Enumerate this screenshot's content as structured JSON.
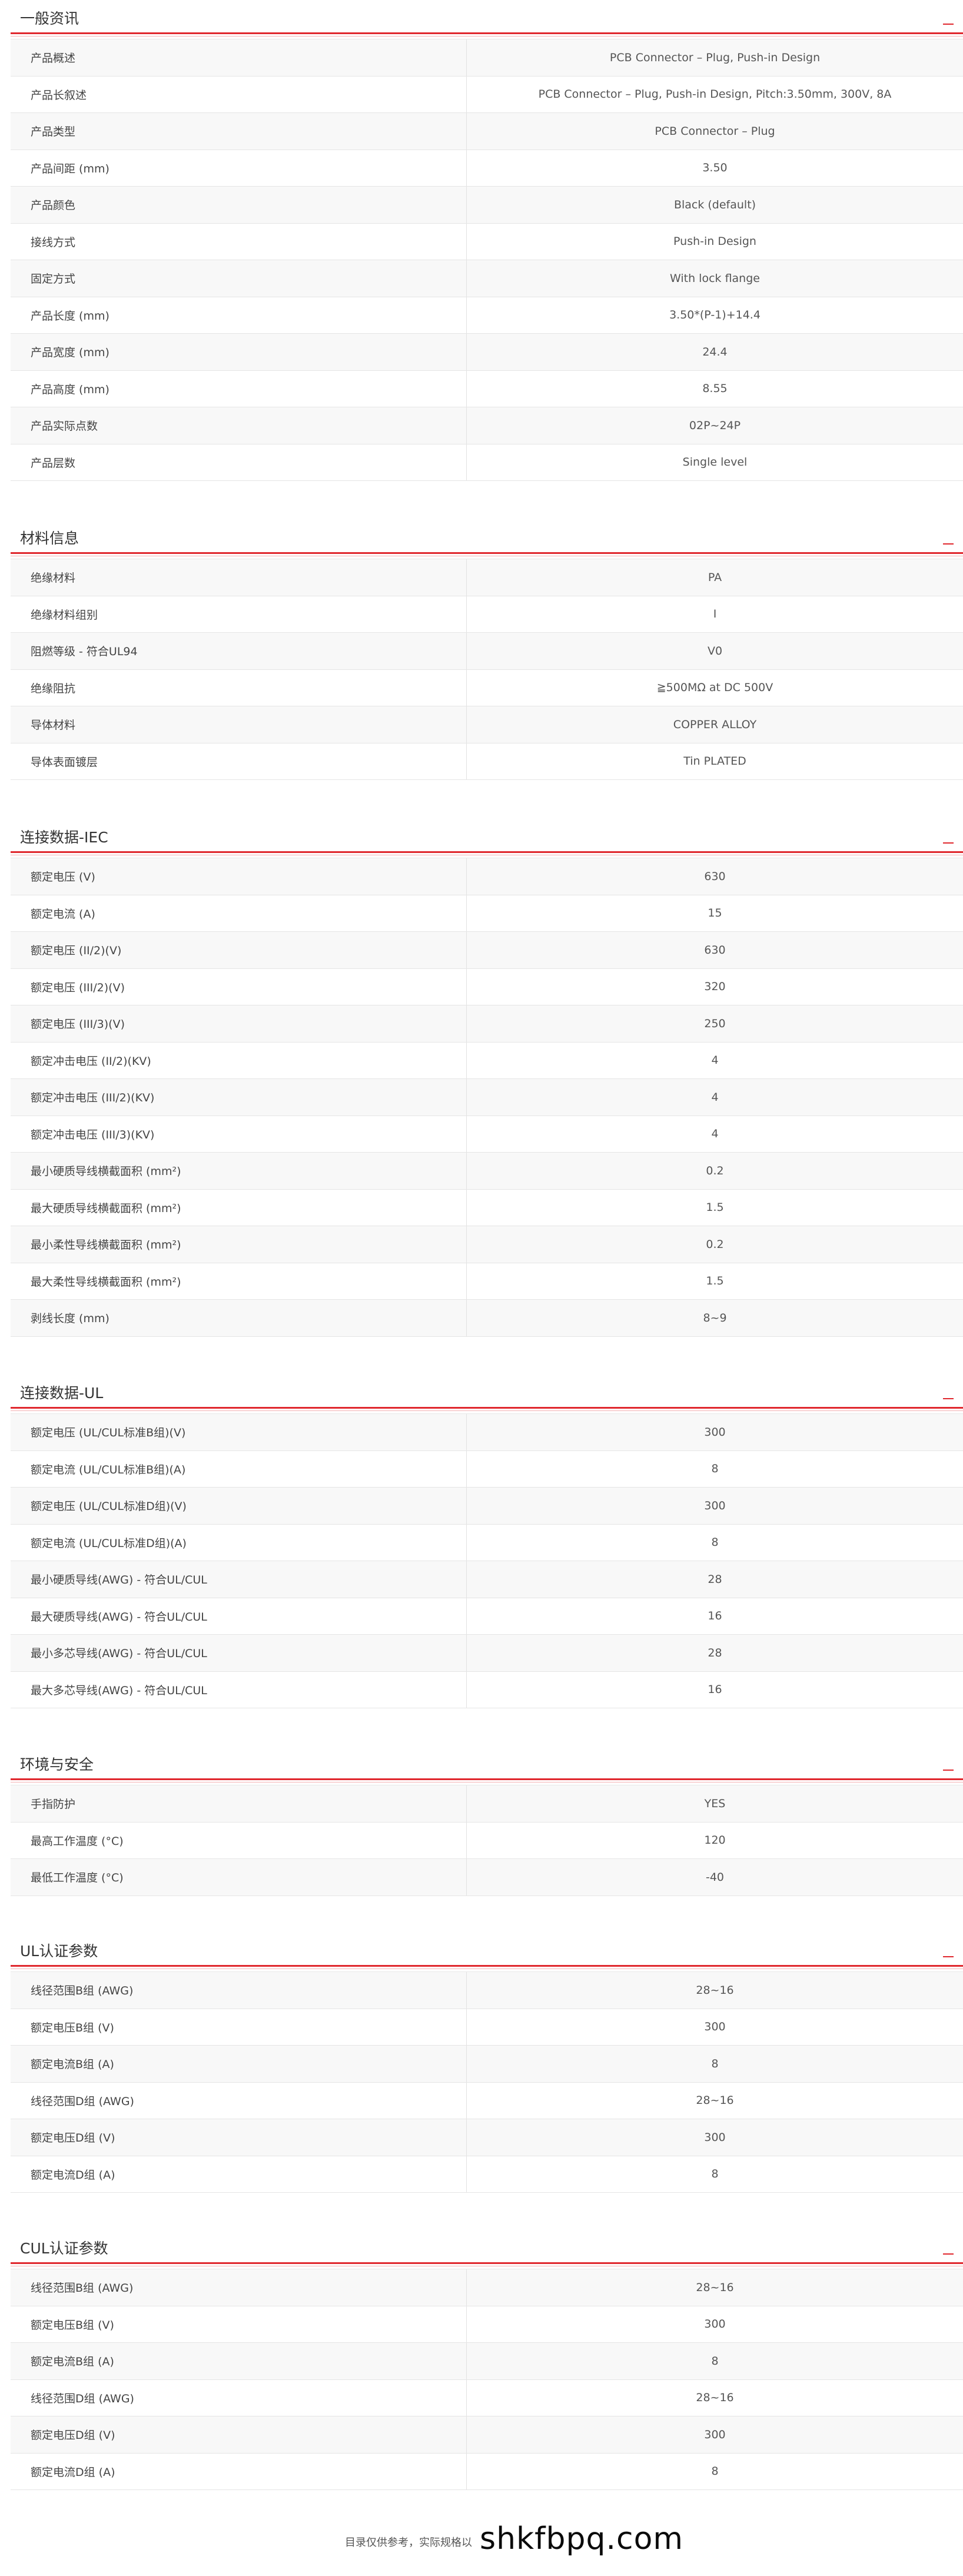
{
  "sections": [
    {
      "title": "一般资讯",
      "rows": [
        {
          "label": "产品概述",
          "value": "PCB Connector – Plug, Push-in Design"
        },
        {
          "label": "产品长叙述",
          "value": "PCB Connector – Plug, Push-in Design, Pitch:3.50mm, 300V, 8A"
        },
        {
          "label": "产品类型",
          "value": "PCB Connector – Plug"
        },
        {
          "label": "产品间距 (mm)",
          "value": "3.50"
        },
        {
          "label": "产品颜色",
          "value": "Black (default)"
        },
        {
          "label": "接线方式",
          "value": "Push-in Design"
        },
        {
          "label": "固定方式",
          "value": "With lock flange"
        },
        {
          "label": "产品长度 (mm)",
          "value": "3.50*(P-1)+14.4"
        },
        {
          "label": "产品宽度 (mm)",
          "value": "24.4"
        },
        {
          "label": "产品高度 (mm)",
          "value": "8.55"
        },
        {
          "label": "产品实际点数",
          "value": "02P~24P"
        },
        {
          "label": "产品层数",
          "value": "Single level"
        }
      ]
    },
    {
      "title": "材料信息",
      "rows": [
        {
          "label": "绝缘材料",
          "value": "PA"
        },
        {
          "label": "绝缘材料组别",
          "value": "I"
        },
        {
          "label": "阻燃等级 - 符合UL94",
          "value": "V0"
        },
        {
          "label": "绝缘阻抗",
          "value": "≧500MΩ at DC 500V"
        },
        {
          "label": "导体材料",
          "value": "COPPER ALLOY"
        },
        {
          "label": "导体表面镀层",
          "value": "Tin PLATED"
        }
      ]
    },
    {
      "title": "连接数据-IEC",
      "rows": [
        {
          "label": "额定电压 (V)",
          "value": "630"
        },
        {
          "label": "额定电流 (A)",
          "value": "15"
        },
        {
          "label": "额定电压 (II/2)(V)",
          "value": "630"
        },
        {
          "label": "额定电压 (III/2)(V)",
          "value": "320"
        },
        {
          "label": "额定电压 (III/3)(V)",
          "value": "250"
        },
        {
          "label": "额定冲击电压 (II/2)(KV)",
          "value": "4"
        },
        {
          "label": "额定冲击电压 (III/2)(KV)",
          "value": "4"
        },
        {
          "label": "额定冲击电压 (III/3)(KV)",
          "value": "4"
        },
        {
          "label": "最小硬质导线横截面积 (mm²)",
          "value": "0.2"
        },
        {
          "label": "最大硬质导线横截面积 (mm²)",
          "value": "1.5"
        },
        {
          "label": "最小柔性导线横截面积 (mm²)",
          "value": "0.2"
        },
        {
          "label": "最大柔性导线横截面积 (mm²)",
          "value": "1.5"
        },
        {
          "label": "剥线长度 (mm)",
          "value": "8~9"
        }
      ]
    },
    {
      "title": "连接数据-UL",
      "rows": [
        {
          "label": "额定电压 (UL/CUL标准B组)(V)",
          "value": "300"
        },
        {
          "label": "额定电流 (UL/CUL标准B组)(A)",
          "value": "8"
        },
        {
          "label": "额定电压 (UL/CUL标准D组)(V)",
          "value": "300"
        },
        {
          "label": "额定电流 (UL/CUL标准D组)(A)",
          "value": "8"
        },
        {
          "label": "最小硬质导线(AWG) - 符合UL/CUL",
          "value": "28"
        },
        {
          "label": "最大硬质导线(AWG) - 符合UL/CUL",
          "value": "16"
        },
        {
          "label": "最小多芯导线(AWG) - 符合UL/CUL",
          "value": "28"
        },
        {
          "label": "最大多芯导线(AWG) - 符合UL/CUL",
          "value": "16"
        }
      ]
    },
    {
      "title": "环境与安全",
      "rows": [
        {
          "label": "手指防护",
          "value": "YES"
        },
        {
          "label": "最高工作温度 (°C)",
          "value": "120"
        },
        {
          "label": "最低工作温度 (°C)",
          "value": "-40"
        }
      ]
    },
    {
      "title": "UL认证参数",
      "rows": [
        {
          "label": "线径范围B组 (AWG)",
          "value": "28~16"
        },
        {
          "label": "额定电压B组 (V)",
          "value": "300"
        },
        {
          "label": "额定电流B组 (A)",
          "value": "8"
        },
        {
          "label": "线径范围D组 (AWG)",
          "value": "28~16"
        },
        {
          "label": "额定电压D组 (V)",
          "value": "300"
        },
        {
          "label": "额定电流D组 (A)",
          "value": "8"
        }
      ]
    },
    {
      "title": "CUL认证参数",
      "rows": [
        {
          "label": "线径范围B组 (AWG)",
          "value": "28~16"
        },
        {
          "label": "额定电压B组 (V)",
          "value": "300"
        },
        {
          "label": "额定电流B组 (A)",
          "value": "8"
        },
        {
          "label": "线径范围D组 (AWG)",
          "value": "28~16"
        },
        {
          "label": "额定电压D组 (V)",
          "value": "300"
        },
        {
          "label": "额定电流D组 (A)",
          "value": "8"
        }
      ]
    }
  ],
  "footer": {
    "note": "目录仅供参考，实际规格以",
    "watermark": "shkfbpq.com"
  },
  "colors": {
    "accent": "#e0282e",
    "row_alt": "#f8f8f8",
    "border": "#e5e5e5"
  },
  "icons": {
    "section_toggle": "collapse-minus-icon"
  }
}
